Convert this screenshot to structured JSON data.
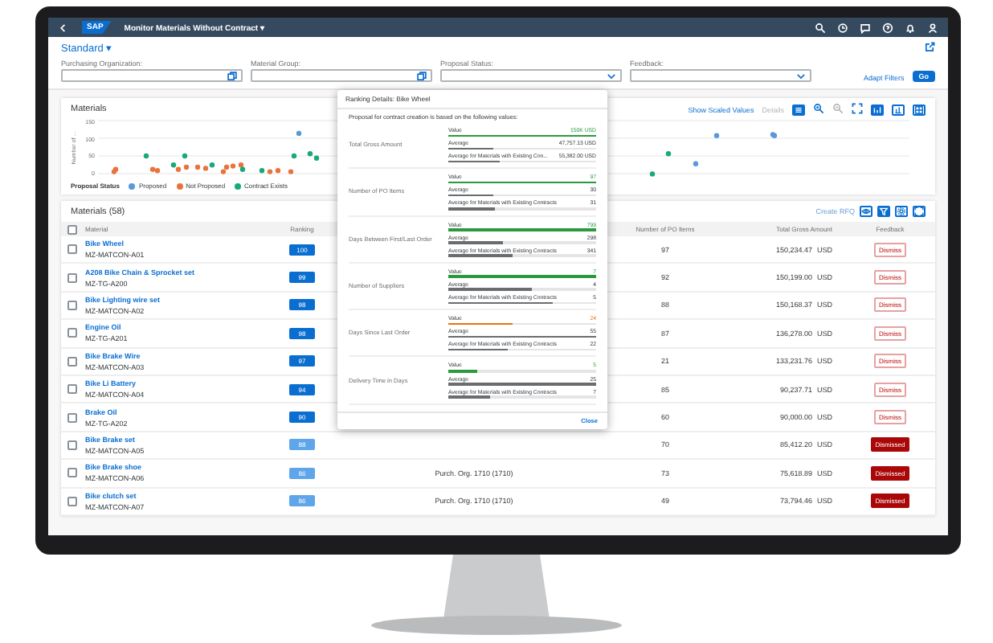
{
  "shell": {
    "logo": "SAP",
    "title": "Monitor Materials Without Contract",
    "title_caret": "▾"
  },
  "filter_bar": {
    "variant": "Standard",
    "variant_caret": "▾",
    "filters": [
      {
        "label": "Purchasing Organization:",
        "kind": "valuehelp"
      },
      {
        "label": "Material Group:",
        "kind": "valuehelp"
      },
      {
        "label": "Proposal Status:",
        "kind": "dropdown"
      },
      {
        "label": "Feedback:",
        "kind": "dropdown"
      }
    ],
    "adapt_filters": "Adapt Filters",
    "go": "Go"
  },
  "chart": {
    "title": "Materials",
    "show_scaled_values": "Show Scaled Values",
    "details": {
      "label": "Details",
      "disabled": true
    },
    "ylabel": "Number of ...",
    "yticks": [
      "150",
      "100",
      "50",
      "0"
    ],
    "legend_title": "Proposal Status",
    "legend": [
      {
        "label": "Proposed",
        "color": "#5899da"
      },
      {
        "label": "Not Proposed",
        "color": "#e8743b"
      },
      {
        "label": "Contract Exists",
        "color": "#19a979"
      }
    ]
  },
  "table": {
    "title": "Materials (58)",
    "create_rfq": "Create RFQ",
    "select_all_checked": false,
    "columns": [
      "Material",
      "Ranking",
      "Number of PO Items",
      "Total Gross Amount",
      "Feedback"
    ],
    "rows": [
      {
        "checked": false,
        "material": "Bike Wheel",
        "id": "MZ-MATCON-A01",
        "ranking": "100",
        "color": "#0a6ed1",
        "po_items": "97",
        "amount": "150,234.47",
        "currency": "USD",
        "feedback": "Dismiss",
        "dismissed": false
      },
      {
        "checked": false,
        "material": "A208 Bike Chain & Sprocket set",
        "id": "MZ-TG-A200",
        "ranking": "99",
        "color": "#0a6ed1",
        "po_items": "92",
        "amount": "150,199.00",
        "currency": "USD",
        "feedback": "Dismiss",
        "dismissed": false
      },
      {
        "checked": false,
        "material": "Bike Lighting wire set",
        "id": "MZ-MATCON-A02",
        "ranking": "98",
        "color": "#0a6ed1",
        "po_items": "88",
        "amount": "150,168.37",
        "currency": "USD",
        "feedback": "Dismiss",
        "dismissed": false
      },
      {
        "checked": false,
        "material": "Engine Oil",
        "id": "MZ-TG-A201",
        "ranking": "98",
        "color": "#0a6ed1",
        "po_items": "87",
        "amount": "136,278.00",
        "currency": "USD",
        "feedback": "Dismiss",
        "dismissed": false
      },
      {
        "checked": false,
        "material": "Bike Brake Wire",
        "id": "MZ-MATCON-A03",
        "ranking": "97",
        "color": "#0a6ed1",
        "po_items": "21",
        "amount": "133,231.76",
        "currency": "USD",
        "feedback": "Dismiss",
        "dismissed": false
      },
      {
        "checked": false,
        "material": "Bike Li Battery",
        "id": "MZ-MATCON-A04",
        "ranking": "94",
        "color": "#0a6ed1",
        "po_items": "85",
        "amount": "90,237.71",
        "currency": "USD",
        "feedback": "Dismiss",
        "dismissed": false
      },
      {
        "checked": false,
        "material": "Brake Oil",
        "id": "MZ-TG-A202",
        "ranking": "90",
        "color": "#0a6ed1",
        "po_items": "60",
        "amount": "90,000.00",
        "currency": "USD",
        "feedback": "Dismiss",
        "dismissed": false
      },
      {
        "checked": false,
        "material": "Bike Brake set",
        "id": "MZ-MATCON-A05",
        "ranking": "88",
        "color": "#5ea5ea",
        "po_items": "70",
        "amount": "85,412.20",
        "currency": "USD",
        "feedback": "Dismissed",
        "dismissed": true
      },
      {
        "checked": false,
        "material": "Bike Brake shoe",
        "id": "MZ-MATCON-A06",
        "ranking": "86",
        "color": "#5ea5ea",
        "purch_org": "Purch. Org. 1710 (1710)",
        "po_items": "73",
        "amount": "75,618.89",
        "currency": "USD",
        "feedback": "Dismissed",
        "dismissed": true
      },
      {
        "checked": false,
        "material": "Bike clutch set",
        "id": "MZ-MATCON-A07",
        "ranking": "86",
        "color": "#5ea5ea",
        "purch_org": "Purch. Org. 1710 (1710)",
        "po_items": "49",
        "amount": "73,794.46",
        "currency": "USD",
        "feedback": "Dismissed",
        "dismissed": true
      }
    ]
  },
  "popup": {
    "title": "Ranking Details: Bike Wheel",
    "subtitle": "Proposal for contract creation is based on the following values:",
    "metrics": [
      {
        "label": "Total Gross Amount",
        "bars": [
          {
            "label": "Value",
            "reading": "150K USD",
            "level": 1,
            "color": "#2b9a3e"
          },
          {
            "label": "Average",
            "reading": "47,757.13 USD",
            "level": 0.3,
            "color": "#6a6d70"
          },
          {
            "label": "Average for Materials with Existing Con...",
            "reading": "55,382.00 USD",
            "level": 0.35,
            "color": "#6a6d70"
          }
        ]
      },
      {
        "label": "Number of PO Items",
        "bars": [
          {
            "label": "Value",
            "reading": "97",
            "level": 1,
            "color": "#2b9a3e"
          },
          {
            "label": "Average",
            "reading": "30",
            "level": 0.3,
            "color": "#6a6d70"
          },
          {
            "label": "Average for Materials with Existing Contracts",
            "reading": "31",
            "level": 0.32,
            "color": "#6a6d70"
          }
        ]
      },
      {
        "label": "Days Between First/Last Order",
        "bars": [
          {
            "label": "Value",
            "reading": "799",
            "level": 1,
            "color": "#2b9a3e"
          },
          {
            "label": "Average",
            "reading": "298",
            "level": 0.37,
            "color": "#6a6d70"
          },
          {
            "label": "Average for Materials with Existing Contracts",
            "reading": "341",
            "level": 0.43,
            "color": "#6a6d70"
          }
        ]
      },
      {
        "label": "Number of Suppliers",
        "bars": [
          {
            "label": "Value",
            "reading": "7",
            "level": 1,
            "color": "#2b9a3e"
          },
          {
            "label": "Average",
            "reading": "4",
            "level": 0.57,
            "color": "#6a6d70"
          },
          {
            "label": "Average for Materials with Existing Contracts",
            "reading": "5",
            "level": 0.71,
            "color": "#6a6d70"
          }
        ]
      },
      {
        "label": "Days Since Last Order",
        "bars": [
          {
            "label": "Value",
            "reading": "24",
            "level": 0.44,
            "color": "#e9730c"
          },
          {
            "label": "Average",
            "reading": "55",
            "level": 1,
            "color": "#6a6d70"
          },
          {
            "label": "Average for Materials with Existing Contracts",
            "reading": "22",
            "level": 0.4,
            "color": "#6a6d70"
          }
        ]
      },
      {
        "label": "Delivery Time in Days",
        "bars": [
          {
            "label": "Value",
            "reading": "5",
            "level": 0.2,
            "color": "#2b9a3e"
          },
          {
            "label": "Average",
            "reading": "25",
            "level": 1,
            "color": "#6a6d70"
          },
          {
            "label": "Average for Materials with Existing Contracts",
            "reading": "7",
            "level": 0.28,
            "color": "#6a6d70"
          }
        ]
      }
    ],
    "close": "Close"
  }
}
